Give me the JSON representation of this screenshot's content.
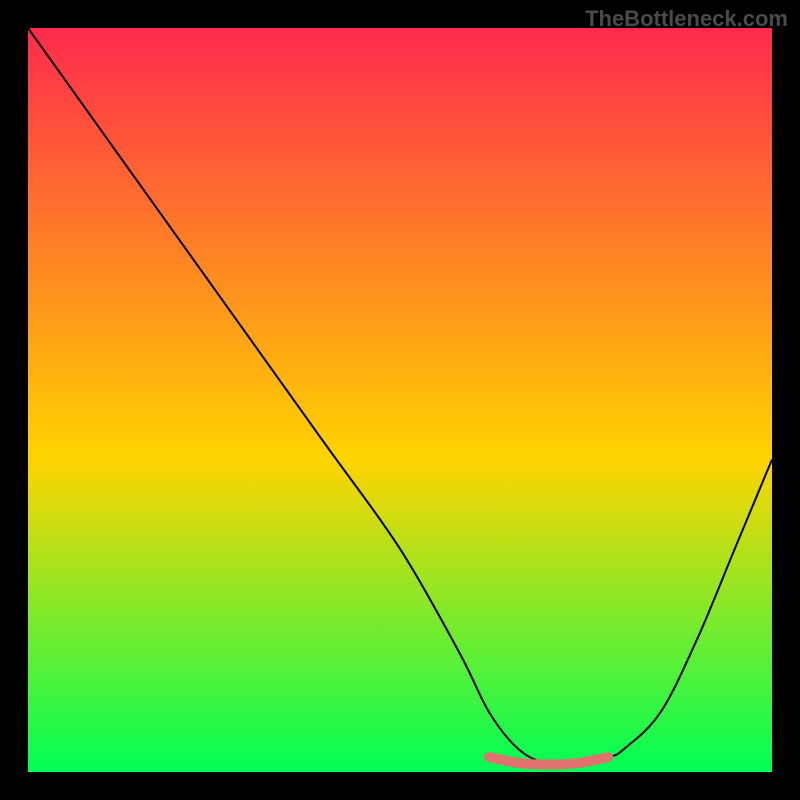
{
  "watermark": "TheBottleneck.com",
  "chart_data": {
    "type": "line",
    "title": "",
    "xlabel": "",
    "ylabel": "",
    "xlim": [
      0,
      100
    ],
    "ylim": [
      0,
      100
    ],
    "background_gradient": {
      "top": "#ff2a4d",
      "mid": "#ffd400",
      "bottom": "#00ff55"
    },
    "curve": {
      "color": "#000000",
      "stroke_width": 2,
      "x": [
        0,
        10,
        20,
        30,
        40,
        50,
        58,
        62,
        66,
        70,
        74,
        78,
        80,
        85,
        90,
        95,
        100
      ],
      "y": [
        100,
        86,
        72,
        58,
        44,
        30,
        16,
        8,
        3,
        1,
        1,
        2,
        3,
        8,
        18,
        30,
        42
      ]
    },
    "highlight_segment": {
      "color": "#e0736e",
      "stroke_width": 10,
      "x": [
        62,
        66,
        70,
        74,
        78
      ],
      "y": [
        2,
        1.2,
        1,
        1.2,
        2
      ]
    }
  }
}
